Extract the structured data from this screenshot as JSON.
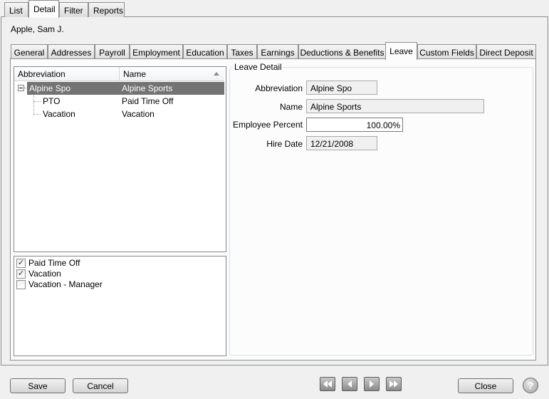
{
  "top_tabs": [
    "List",
    "Detail",
    "Filter",
    "Reports"
  ],
  "employee_name": "Apple, Sam J.",
  "sub_tabs": [
    "General",
    "Addresses",
    "Payroll",
    "Employment",
    "Education",
    "Taxes",
    "Earnings",
    "Deductions & Benefits",
    "Leave",
    "Custom Fields",
    "Direct Deposit"
  ],
  "tree": {
    "headers": {
      "abbreviation": "Abbreviation",
      "name": "Name"
    },
    "rows": [
      {
        "abbreviation": "Alpine Spo",
        "name": "Alpine Sports"
      },
      {
        "abbreviation": "PTO",
        "name": "Paid Time Off"
      },
      {
        "abbreviation": "Vacation",
        "name": "Vacation"
      }
    ]
  },
  "checklist": [
    {
      "label": "Paid Time Off",
      "checked": true
    },
    {
      "label": "Vacation",
      "checked": true
    },
    {
      "label": "Vacation - Manager",
      "checked": false
    }
  ],
  "leave_detail": {
    "title": "Leave Detail",
    "abbreviation_label": "Abbreviation",
    "abbreviation_value": "Alpine Spo",
    "name_label": "Name",
    "name_value": "Alpine Sports",
    "percent_label": "Employee Percent",
    "percent_value": "100.00%",
    "hire_label": "Hire Date",
    "hire_value": "12/21/2008"
  },
  "buttons": {
    "save": "Save",
    "cancel": "Cancel",
    "close": "Close",
    "help": "?"
  },
  "icons": [
    "expand-minus-icon",
    "sort-arrow-icon",
    "checkmark-icon",
    "first-record-icon",
    "previous-record-icon",
    "next-record-icon",
    "last-record-icon",
    "help-icon"
  ],
  "colors": {
    "selection": "#737373",
    "background": "#f0f0f0"
  }
}
